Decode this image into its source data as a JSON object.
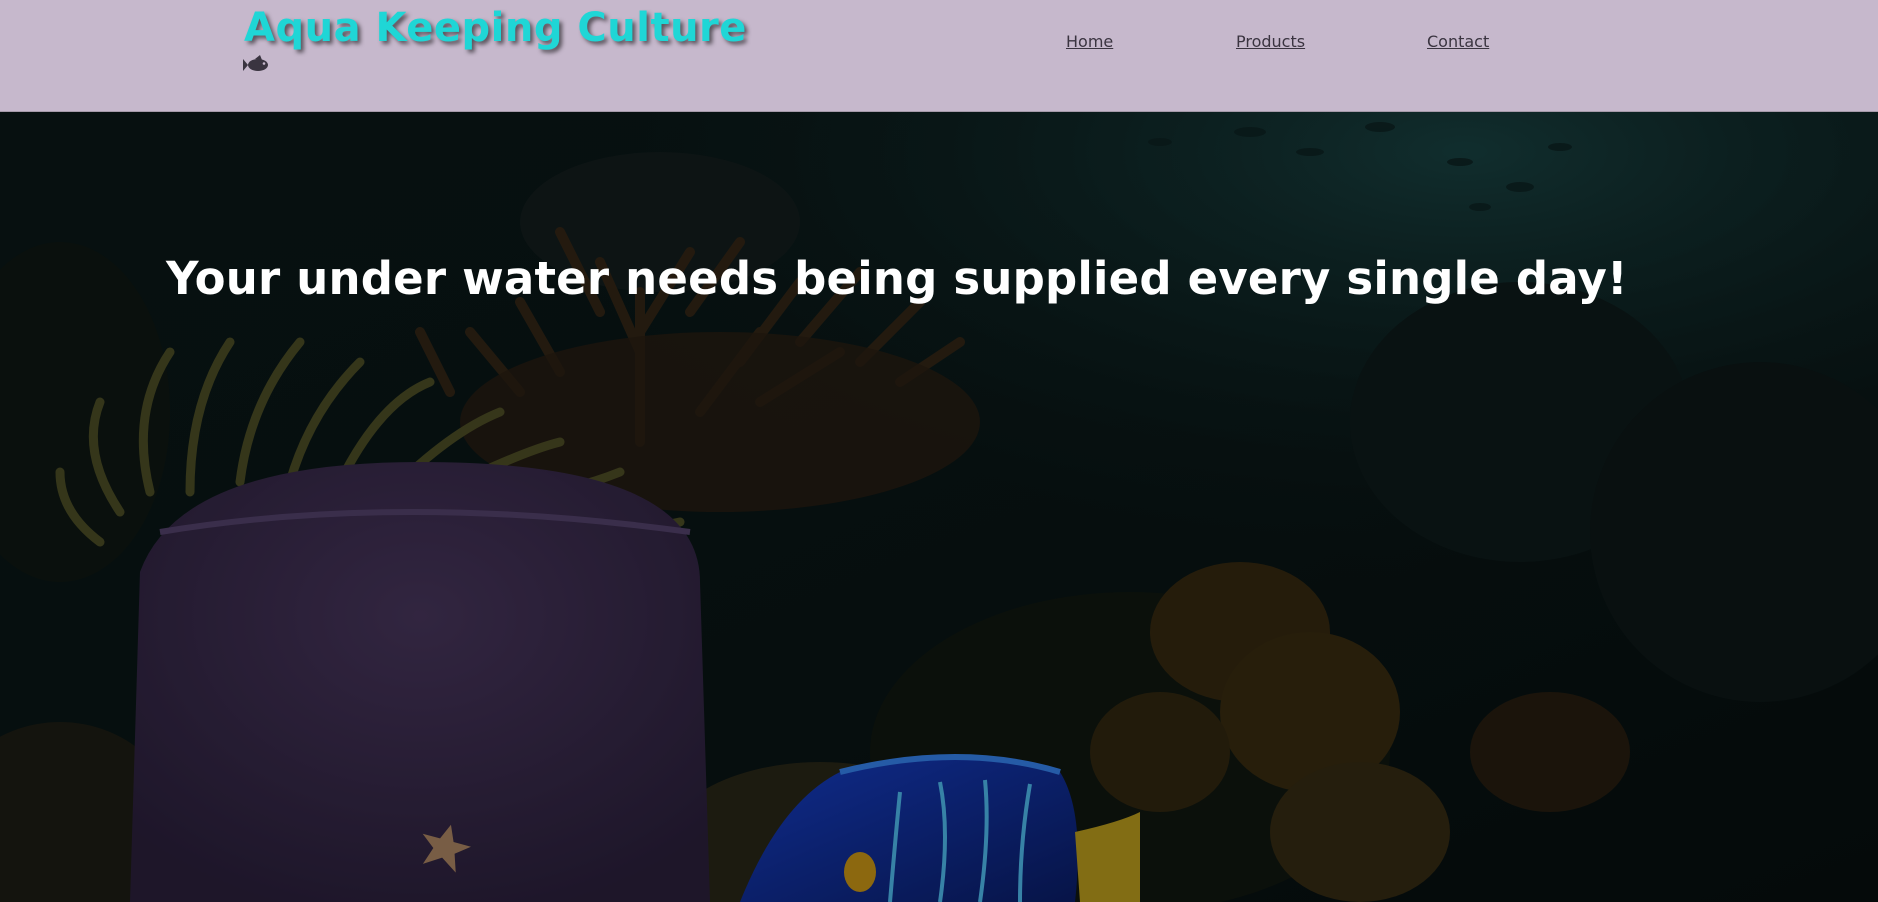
{
  "site": {
    "title": "Aqua Keeping Culture",
    "logo_icon": "fish-icon"
  },
  "nav": {
    "home": "Home",
    "products": "Products",
    "contact": "Contact"
  },
  "hero": {
    "headline": "Your under water needs being supplied every single day!",
    "image": "underwater-reef-scene"
  },
  "colors": {
    "header_bg": "#c6b8cc",
    "title": "#1fd6d6",
    "nav_text": "#3a3440",
    "hero_text": "#ffffff"
  }
}
